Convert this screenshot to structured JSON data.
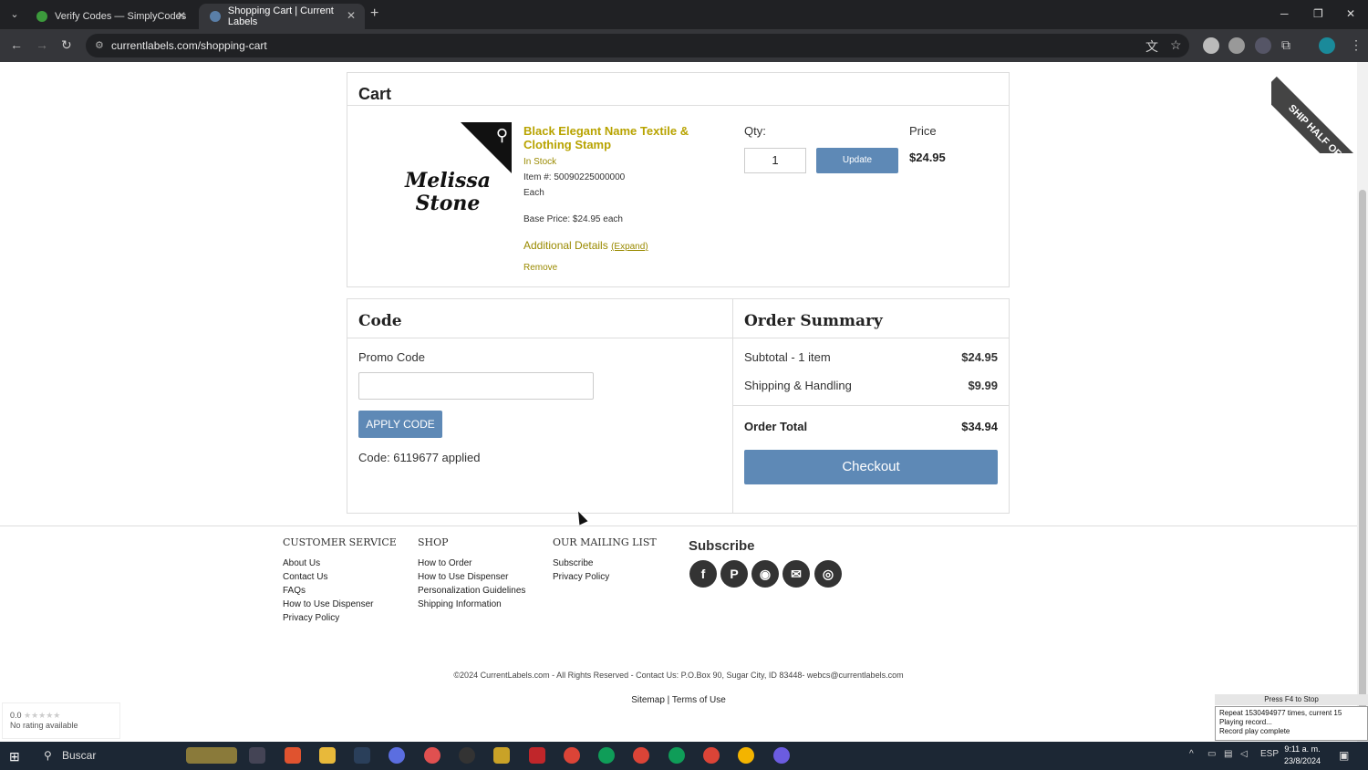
{
  "browser": {
    "tabs": [
      {
        "title": "Verify Codes — SimplyCodes",
        "close": "✕"
      },
      {
        "title": "Shopping Cart | Current Labels",
        "close": "✕"
      }
    ],
    "new_tab": "+",
    "url": "currentlabels.com/shopping-cart",
    "window": {
      "minimize": "─",
      "maximize": "❐",
      "close": "✕"
    }
  },
  "banner": {
    "text": "SHIP HALF OFF"
  },
  "cart": {
    "heading": "Cart",
    "product": {
      "image_text_line1": "Melissa",
      "image_text_line2": "Stone",
      "name": "Black Elegant Name Textile & Clothing Stamp",
      "stock": "In Stock",
      "item_number": "Item #: 50090225000000",
      "unit": "Each",
      "base_price": "Base Price: $24.95 each",
      "additional_details": "Additional Details",
      "expand": "(Expand)",
      "remove": "Remove"
    },
    "qty_label": "Qty:",
    "qty_value": "1",
    "update_label": "Update",
    "price_label": "Price",
    "price_value": "$24.95"
  },
  "code": {
    "heading": "Code",
    "promo_label": "Promo Code",
    "promo_value": "",
    "apply_label": "APPLY CODE",
    "applied_message": "Code: 6119677 applied"
  },
  "summary": {
    "heading": "Order Summary",
    "subtotal_label": "Subtotal - 1 item",
    "subtotal_value": "$24.95",
    "shipping_label": "Shipping & Handling",
    "shipping_value": "$9.99",
    "total_label": "Order Total",
    "total_value": "$34.94",
    "checkout_label": "Checkout"
  },
  "footer": {
    "customer_service": {
      "heading": "CUSTOMER SERVICE",
      "links": [
        "About Us",
        "Contact Us",
        "FAQs",
        "How to Use Dispenser",
        "Privacy Policy"
      ]
    },
    "shop": {
      "heading": "SHOP",
      "links": [
        "How to Order",
        "How to Use Dispenser",
        "Personalization Guidelines",
        "Shipping Information"
      ]
    },
    "mailing": {
      "heading": "OUR MAILING LIST",
      "links": [
        "Subscribe",
        "Privacy Policy"
      ]
    },
    "subscribe_heading": "Subscribe",
    "social": {
      "facebook": "f",
      "pinterest": "P",
      "rss": "◉",
      "email": "✉",
      "instagram": "◎"
    },
    "copyright": "©2024 CurrentLabels.com - All Rights Reserved - Contact Us: P.O.Box 90, Sugar City, ID 83448- webcs@currentlabels.com",
    "sitemap": "Sitemap",
    "separator": "|",
    "terms": "Terms of Use"
  },
  "rating_widget": {
    "score": "0.0",
    "stars": "★★★★★",
    "text": "No rating available"
  },
  "recorder": {
    "title": "Press F4 to Stop",
    "line1": "Repeat 1530494977 times, current 15",
    "line2": "Playing record...",
    "line3": "Record play complete"
  },
  "taskbar": {
    "search_placeholder": "Buscar",
    "language": "ESP",
    "time": "9:11 a. m.",
    "date": "23/8/2024"
  },
  "colors": {
    "accent_button": "#5e89b6",
    "product_link": "#b8a300",
    "chrome_dark": "#202124",
    "taskbar": "#1c2734"
  }
}
